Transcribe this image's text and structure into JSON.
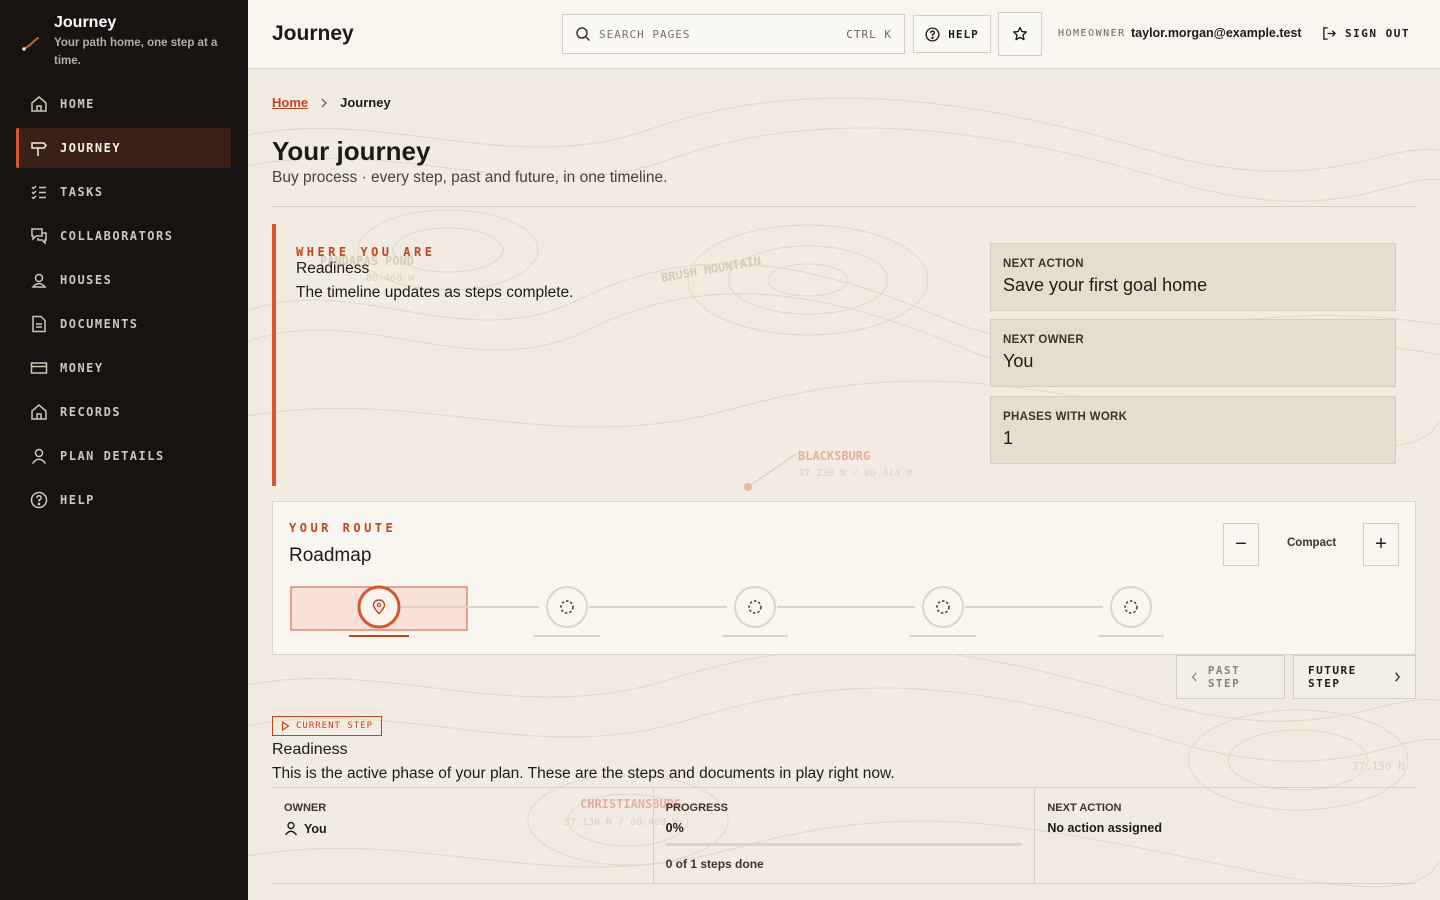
{
  "brand": {
    "title": "Journey",
    "tagline": "Your path home, one step at a time."
  },
  "nav": [
    {
      "label": "HOME",
      "icon": "home-icon",
      "active": false
    },
    {
      "label": "JOURNEY",
      "icon": "signpost-icon",
      "active": true
    },
    {
      "label": "TASKS",
      "icon": "checklist-icon",
      "active": false
    },
    {
      "label": "COLLABORATORS",
      "icon": "chat-icon",
      "active": false
    },
    {
      "label": "HOUSES",
      "icon": "user-icon",
      "active": false
    },
    {
      "label": "DOCUMENTS",
      "icon": "document-icon",
      "active": false
    },
    {
      "label": "MONEY",
      "icon": "card-icon",
      "active": false
    },
    {
      "label": "RECORDS",
      "icon": "home-icon",
      "active": false
    },
    {
      "label": "PLAN DETAILS",
      "icon": "user-icon",
      "active": false
    },
    {
      "label": "HELP",
      "icon": "help-icon",
      "active": false
    }
  ],
  "header": {
    "title": "Journey",
    "search_placeholder": "SEARCH PAGES",
    "search_shortcut": "CTRL K",
    "help_label": "HELP",
    "role": "HOMEOWNER",
    "email": "taylor.morgan@example.test",
    "signout_label": "SIGN OUT"
  },
  "breadcrumb": {
    "home": "Home",
    "current": "Journey"
  },
  "page": {
    "title": "Your journey",
    "subtitle": "Buy process · every step, past and future, in one timeline."
  },
  "where": {
    "eyebrow": "WHERE YOU ARE",
    "phase": "Readiness",
    "description": "The timeline updates as steps complete."
  },
  "stats": [
    {
      "label": "NEXT ACTION",
      "value": "Save your first goal home"
    },
    {
      "label": "NEXT OWNER",
      "value": "You"
    },
    {
      "label": "PHASES WITH WORK",
      "value": "1"
    }
  ],
  "map_labels": [
    {
      "name": "PANDAPAS POND",
      "coord": "80.468 W"
    },
    {
      "name": "BRUSH MOUNTAIN",
      "coord": ""
    },
    {
      "name": "BLACKSBURG",
      "coord": "37.230 N / 80.414 W"
    },
    {
      "name": "CHRISTIANSBURG",
      "coord": "37.130 N / 80.409 W"
    },
    {
      "name": "",
      "coord": "37.150 N"
    }
  ],
  "route": {
    "eyebrow": "YOUR ROUTE",
    "title": "Roadmap",
    "zoom_label": "Compact",
    "zoom_out": "−",
    "zoom_in": "+",
    "steps": [
      {
        "state": "current"
      },
      {
        "state": "future"
      },
      {
        "state": "future"
      },
      {
        "state": "future"
      },
      {
        "state": "future"
      }
    ]
  },
  "step_nav": {
    "past": "PAST STEP",
    "future": "FUTURE STEP"
  },
  "current": {
    "badge": "CURRENT STEP",
    "title": "Readiness",
    "description": "This is the active phase of your plan. These are the steps and documents in play right now.",
    "owner_label": "OWNER",
    "owner": "You",
    "progress_label": "PROGRESS",
    "progress": "0%",
    "progress_fraction": 0,
    "progress_text": "0 of 1 steps done",
    "next_label": "NEXT ACTION",
    "next_value": "No action assigned"
  },
  "colors": {
    "accent": "#c1451f",
    "sidebar": "#161311",
    "background": "#f1ebe1"
  }
}
